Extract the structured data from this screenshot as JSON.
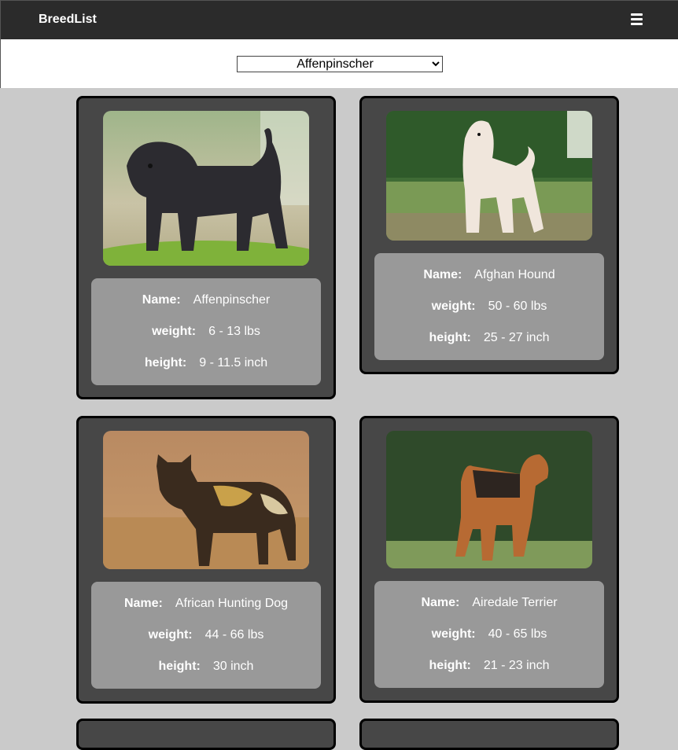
{
  "app": {
    "brand": "BreedList",
    "menu_icon": "hamburger-icon"
  },
  "selector": {
    "selected": "Affenpinscher",
    "options": [
      "Affenpinscher"
    ]
  },
  "labels": {
    "name": "Name:",
    "weight": "weight:",
    "height": "height:"
  },
  "breeds": [
    {
      "name": "Affenpinscher",
      "weight": "6 - 13 lbs",
      "height": "9 - 11.5 inch",
      "image": "affenpinscher-photo"
    },
    {
      "name": "Afghan Hound",
      "weight": "50 - 60 lbs",
      "height": "25 - 27 inch",
      "image": "afghan-hound-photo"
    },
    {
      "name": "African Hunting Dog",
      "weight": "44 - 66 lbs",
      "height": "30 inch",
      "image": "african-hunting-dog-photo"
    },
    {
      "name": "Airedale Terrier",
      "weight": "40 - 65 lbs",
      "height": "21 - 23 inch",
      "image": "airedale-terrier-photo"
    }
  ],
  "colors": {
    "navbar": "#2b2b2b",
    "background": "#cacaca",
    "card": "#474747",
    "info_panel": "#999999"
  }
}
